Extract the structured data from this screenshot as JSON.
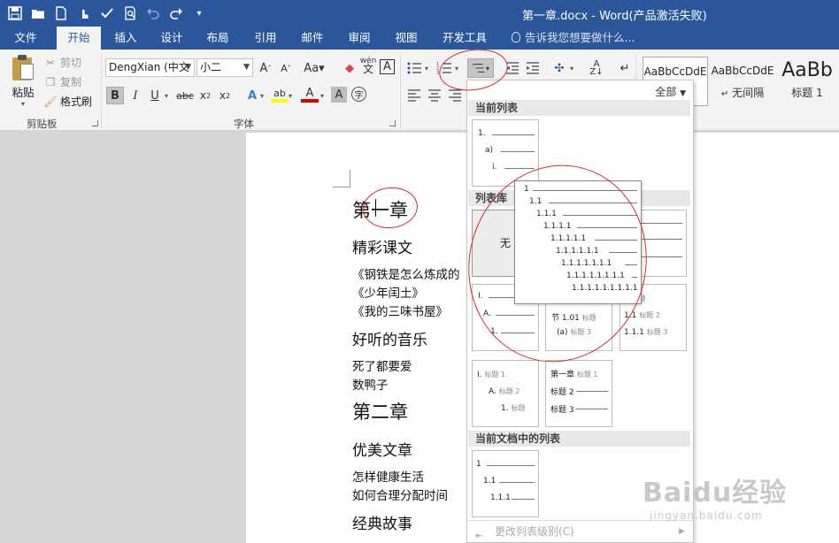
{
  "window": {
    "title": "第一章.docx - Word(产品激活失败)"
  },
  "tabs": [
    "文件",
    "开始",
    "插入",
    "设计",
    "布局",
    "引用",
    "邮件",
    "审阅",
    "视图",
    "开发工具"
  ],
  "tell_me": "告诉我您想要做什么...",
  "clipboard": {
    "paste": "粘贴",
    "cut": "剪切",
    "copy": "复制",
    "format_painter": "格式刷",
    "group": "剪贴板"
  },
  "font": {
    "name": "DengXian (中文",
    "size": "小二",
    "group": "字体",
    "pinyin": "wén"
  },
  "styles": {
    "items": [
      {
        "sample": "AaBbCcDdE",
        "name": "正文"
      },
      {
        "sample": "AaBbCcDdE",
        "name": "无间隔"
      },
      {
        "sample": "AaBb",
        "name": "标题 1"
      }
    ]
  },
  "document": {
    "lines": [
      {
        "text": "第一章"
      },
      {
        "text": "精彩课文"
      },
      {
        "text": "《钢铁是怎么炼成的"
      },
      {
        "text": "《少年闰土》"
      },
      {
        "text": "《我的三味书屋》"
      },
      {
        "text": "好听的音乐"
      },
      {
        "text": "死了都要爱"
      },
      {
        "text": "数鸭子"
      },
      {
        "text": "第二章"
      },
      {
        "text": "优美文章"
      },
      {
        "text": "怎样健康生活"
      },
      {
        "text": "如何合理分配时间"
      },
      {
        "text": "经典故事"
      }
    ]
  },
  "multilevel_dropdown": {
    "filter": "全部",
    "section_current": "当前列表",
    "section_library": "列表库",
    "section_document": "当前文档中的列表",
    "none_label": "无",
    "footer": "更改列表级别(C)",
    "current_list": [
      "1.",
      "a)",
      "i."
    ],
    "preview_levels": [
      "1",
      "1.1",
      "1.1.1",
      "1.1.1.1",
      "1.1.1.1.1",
      "1.1.1.1.1.1",
      "1.1.1.1.1.1.1",
      "1.1.1.1.1.1.1.1",
      "1.1.1.1.1.1.1.1.1"
    ],
    "library_tail": "1.",
    "lib_roman": [
      "I.",
      "A.",
      "1."
    ],
    "lib_article": [
      "节 1.01",
      "(a)"
    ],
    "lib_article_tags": [
      "标题",
      "标题 3"
    ],
    "lib_heading_numeric": [
      "1",
      "1.1",
      "1.1.1"
    ],
    "lib_heading_numeric_tags": [
      "标题",
      "标题 2",
      "标题 3"
    ],
    "lib_roman_heading": [
      "I.",
      "A.",
      "1."
    ],
    "lib_roman_heading_tags": [
      "标题 1",
      "标题 2",
      "标题"
    ],
    "lib_chapter": [
      "第一章"
    ],
    "lib_chapter_tags": [
      "标题 1",
      "标题 2",
      "标题 3"
    ],
    "document_list": [
      "1",
      "1.1",
      "1.1.1"
    ]
  },
  "watermark": {
    "main": "Baidu经验",
    "sub": "jingyan.baidu.com"
  },
  "colors": {
    "ribbon_blue": "#2b579a",
    "annotation_red": "#d8292c"
  }
}
